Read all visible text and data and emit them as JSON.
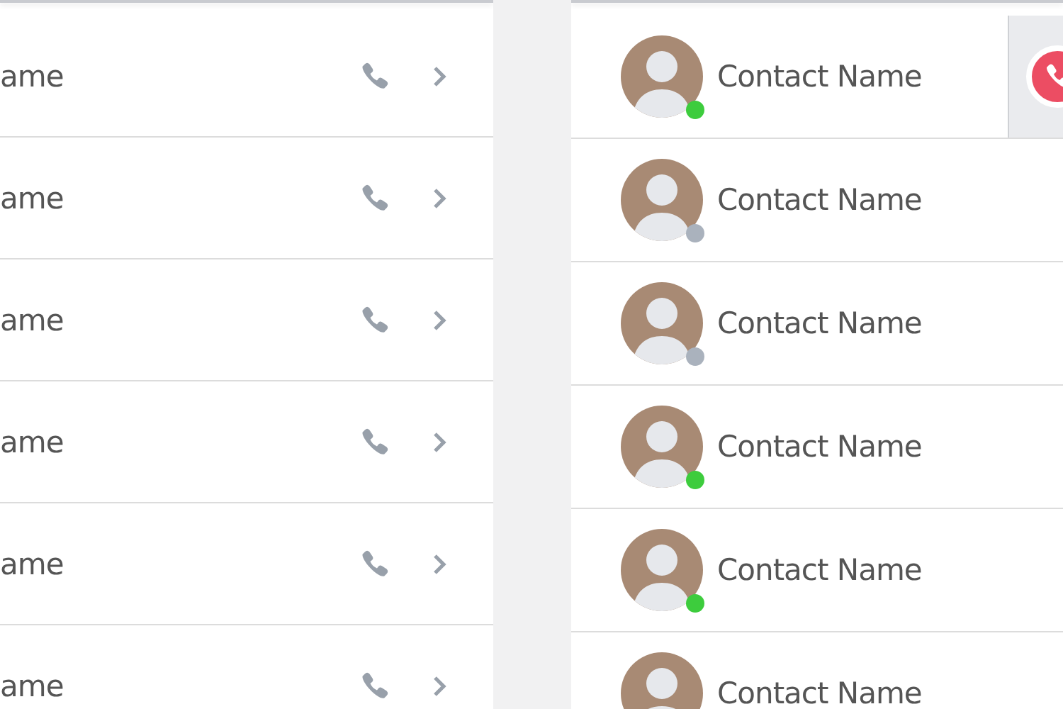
{
  "calls_list": {
    "rows": [
      {
        "name": "ame"
      },
      {
        "name": "ame"
      },
      {
        "name": "ame"
      },
      {
        "name": "ame"
      },
      {
        "name": "ame"
      },
      {
        "name": "ame"
      }
    ]
  },
  "contacts": {
    "rows": [
      {
        "name": "Contact Name",
        "online": true,
        "swiped": true
      },
      {
        "name": "Contact Name",
        "online": false,
        "swiped": false
      },
      {
        "name": "Contact Name",
        "online": false,
        "swiped": false
      },
      {
        "name": "Contact Name",
        "online": true,
        "swiped": false
      },
      {
        "name": "Contact Name",
        "online": true,
        "swiped": false
      },
      {
        "name": "Contact Name",
        "swiped": false
      }
    ]
  }
}
